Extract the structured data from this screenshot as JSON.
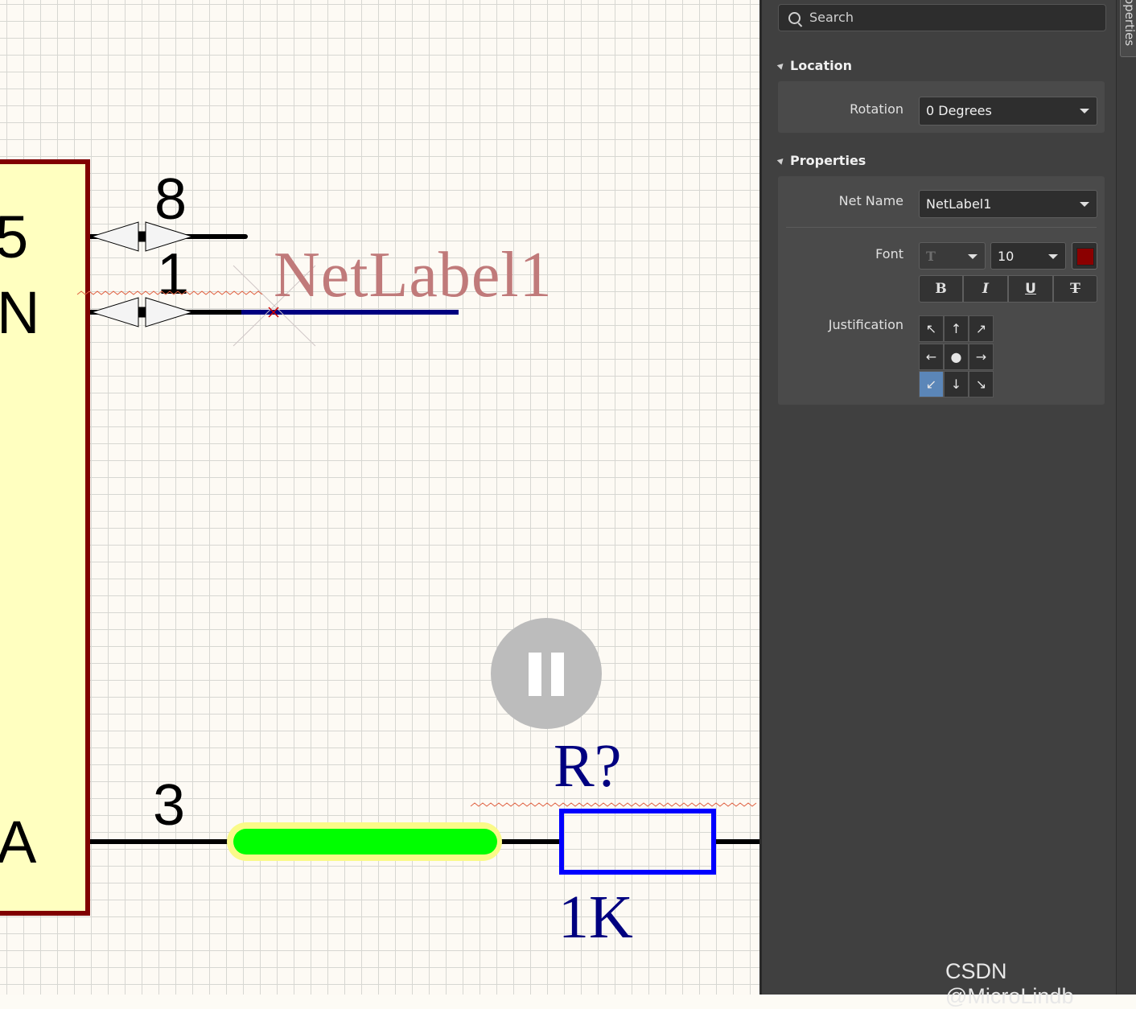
{
  "schematic": {
    "pin_letters": [
      "5",
      "N",
      "A"
    ],
    "pin_numbers": [
      "8",
      "1",
      "3"
    ],
    "net_label": "NetLabel1",
    "resistor": {
      "designator": "R?",
      "value": "1K"
    }
  },
  "panel": {
    "tab_label": "operties",
    "search": {
      "placeholder": "Search"
    },
    "location": {
      "title": "Location",
      "rotation_label": "Rotation",
      "rotation_value": "0 Degrees"
    },
    "properties": {
      "title": "Properties",
      "net_name_label": "Net Name",
      "net_name_value": "NetLabel1",
      "font_label": "Font",
      "font_family_value": "T",
      "font_size_value": "10",
      "font_color": "#8b0000",
      "bold_label": "B",
      "italic_label": "I",
      "underline_label": "U",
      "strike_label": "T",
      "justification_label": "Justification",
      "justification": [
        "↖",
        "↑",
        "↗",
        "←",
        "●",
        "→",
        "↙",
        "↓",
        "↘"
      ],
      "justification_selected": "↙"
    }
  },
  "watermark": "CSDN @MicroLindb",
  "colors": {
    "ic_border": "#800000",
    "ic_fill": "#ffffc0",
    "net_wire": "#000080",
    "net_label_text": "#c07a7a",
    "resistor": "#0000ff",
    "highlight_wire": "#00ff00",
    "panel_bg": "#404040",
    "selected_cell": "#5b86b8"
  }
}
